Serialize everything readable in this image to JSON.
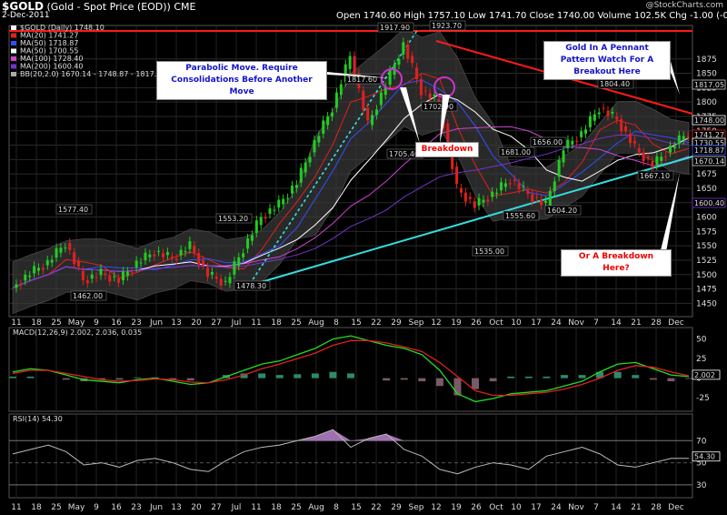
{
  "header": {
    "symbol": "$GOLD",
    "symbol_desc": "(Gold - Spot Price (EOD)) CME",
    "date": "2-Dec-2011",
    "brand": "@StockCharts.com",
    "ohlc": "Open 1740.60  High 1757.10  Low 1741.70  Close 1740.00  Volume 102.5K  Chg -1.00 (-0.06%)"
  },
  "colors": {
    "price_up": "#22cc22",
    "price_down": "#e02020",
    "ma1": "#e02020",
    "ma2": "#3050ff",
    "ma3": "#ffffff",
    "ma4": "#cc44cc",
    "ma5": "#7733cc",
    "trend_upper": "#ff1a1a",
    "trend_lower": "#33dddd",
    "bollinger": "#3a3a3a"
  },
  "legend": [
    {
      "text": "$GOLD (Daily) 1748.10",
      "color": "#ffffff"
    },
    {
      "text": "MA(20) 1741.27",
      "color": "#e02020"
    },
    {
      "text": "MA(50) 1718.87",
      "color": "#3050ff"
    },
    {
      "text": "MA(50) 1700.55",
      "color": "#ffffff"
    },
    {
      "text": "MA(100) 1728.40",
      "color": "#cc44cc"
    },
    {
      "text": "MA(200) 1600.40",
      "color": "#7733cc"
    },
    {
      "text": "BB(20,2.0) 1670.14 - 1748.87 - 1817.61",
      "color": "#aaaaaa"
    }
  ],
  "annotations": {
    "parabolic": "Parabolic Move. Require Consolidations Before Another Move",
    "pennant": "Gold In A Pennant Pattern Watch For A Breakout Here",
    "breakdown1": "Breakdown",
    "breakdown2": "Or A Breakdown Here?"
  },
  "chart_data": [
    {
      "type": "line",
      "title": "$GOLD (Gold - Spot Price (EOD)) CME",
      "y_axis_ticks": [
        1875,
        1850,
        1825,
        1800,
        1775,
        1750,
        1725,
        1700,
        1675,
        1650,
        1625,
        1600,
        1575,
        1550,
        1525,
        1500,
        1475,
        1450
      ],
      "x_ticks": [
        "11",
        "18",
        "25",
        "May",
        "9",
        "16",
        "23",
        "Jun",
        "13",
        "20",
        "27",
        "Jul",
        "11",
        "18",
        "25",
        "Aug",
        "8",
        "15",
        "22",
        "29",
        "Sep",
        "12",
        "19",
        "26",
        "Oct",
        "10",
        "17",
        "24",
        "Nov",
        "7",
        "14",
        "21",
        "28",
        "Dec"
      ],
      "ylim": [
        1430,
        1930
      ],
      "price_points": [
        {
          "label": "Apr",
          "value": 1477
        },
        {
          "label": "Apr",
          "value": 1502
        },
        {
          "label": "Apr 25",
          "value": 1521
        },
        {
          "label": "May",
          "value": 1555
        },
        {
          "label": "May",
          "value": 1490
        },
        {
          "label": "May 9",
          "value": 1502
        },
        {
          "label": "May 16",
          "value": 1490
        },
        {
          "label": "May 23",
          "value": 1520
        },
        {
          "label": "Jun",
          "value": 1540
        },
        {
          "label": "Jun 13",
          "value": 1528
        },
        {
          "label": "Jun 20",
          "value": 1550
        },
        {
          "label": "Jun 27",
          "value": 1500
        },
        {
          "label": "Jul",
          "value": 1485
        },
        {
          "label": "Jul 11",
          "value": 1545
        },
        {
          "label": "Jul 18",
          "value": 1600
        },
        {
          "label": "Jul 25",
          "value": 1622
        },
        {
          "label": "Aug",
          "value": 1660
        },
        {
          "label": "Aug 8",
          "value": 1730
        },
        {
          "label": "Aug 15",
          "value": 1790
        },
        {
          "label": "Aug 22",
          "value": 1880
        },
        {
          "label": "Aug 24",
          "value": 1760
        },
        {
          "label": "Aug 29",
          "value": 1830
        },
        {
          "label": "Sep 6",
          "value": 1900
        },
        {
          "label": "Sep 12",
          "value": 1820
        },
        {
          "label": "Sep 19",
          "value": 1800
        },
        {
          "label": "Sep 22",
          "value": 1650
        },
        {
          "label": "Sep 26",
          "value": 1620
        },
        {
          "label": "Oct",
          "value": 1640
        },
        {
          "label": "Oct 10",
          "value": 1665
        },
        {
          "label": "Oct 17",
          "value": 1640
        },
        {
          "label": "Oct 20",
          "value": 1620
        },
        {
          "label": "Oct 24",
          "value": 1720
        },
        {
          "label": "Nov",
          "value": 1745
        },
        {
          "label": "Nov 7",
          "value": 1790
        },
        {
          "label": "Nov 10",
          "value": 1770
        },
        {
          "label": "Nov 14",
          "value": 1720
        },
        {
          "label": "Nov 21",
          "value": 1690
        },
        {
          "label": "Nov 28",
          "value": 1720
        },
        {
          "label": "Dec",
          "value": 1748
        }
      ],
      "price_labels": [
        "1577.40",
        "1462.00",
        "1553.20",
        "1478.30",
        "1917.90",
        "1923.70",
        "1817.60",
        "1702.90",
        "1705.40",
        "1681.00",
        "1535.00",
        "1555.60",
        "1604.20",
        "1656.00",
        "1804.40",
        "1667.10"
      ],
      "right_axis_values": [
        "1817.05",
        "1748.00",
        "1741.27",
        "1730.55",
        "1718.87",
        "1670.14",
        "1600.40"
      ]
    },
    {
      "type": "line",
      "title": "MACD(12,26,9) 2.002, 2.036, 0.035",
      "y_axis_ticks": [
        50,
        25,
        0,
        -25
      ],
      "right_axis_values": [
        "2.002"
      ],
      "series": [
        {
          "name": "MACD",
          "values": [
            8,
            12,
            10,
            4,
            -2,
            -4,
            -6,
            -2,
            0,
            -4,
            -8,
            -6,
            2,
            10,
            18,
            22,
            30,
            38,
            50,
            54,
            48,
            42,
            38,
            30,
            10,
            -20,
            -30,
            -26,
            -20,
            -18,
            -16,
            -10,
            -4,
            8,
            18,
            20,
            12,
            4,
            2
          ]
        },
        {
          "name": "Signal",
          "values": [
            6,
            10,
            10,
            6,
            2,
            -2,
            -4,
            -3,
            -1,
            -2,
            -5,
            -6,
            -2,
            4,
            12,
            18,
            25,
            32,
            42,
            48,
            48,
            45,
            40,
            34,
            20,
            2,
            -16,
            -22,
            -22,
            -20,
            -18,
            -14,
            -8,
            0,
            10,
            16,
            14,
            8,
            3
          ]
        }
      ]
    },
    {
      "type": "line",
      "title": "RSI(14) 54.30",
      "y_axis_ticks": [
        70,
        54,
        50,
        30
      ],
      "right_axis_values": [
        "54.30"
      ],
      "series": [
        {
          "name": "RSI",
          "values": [
            58,
            62,
            66,
            60,
            48,
            50,
            46,
            52,
            54,
            50,
            44,
            42,
            52,
            60,
            64,
            66,
            70,
            74,
            80,
            64,
            72,
            76,
            62,
            56,
            44,
            40,
            46,
            50,
            48,
            44,
            56,
            60,
            64,
            58,
            48,
            46,
            50,
            54,
            54
          ]
        }
      ]
    }
  ]
}
